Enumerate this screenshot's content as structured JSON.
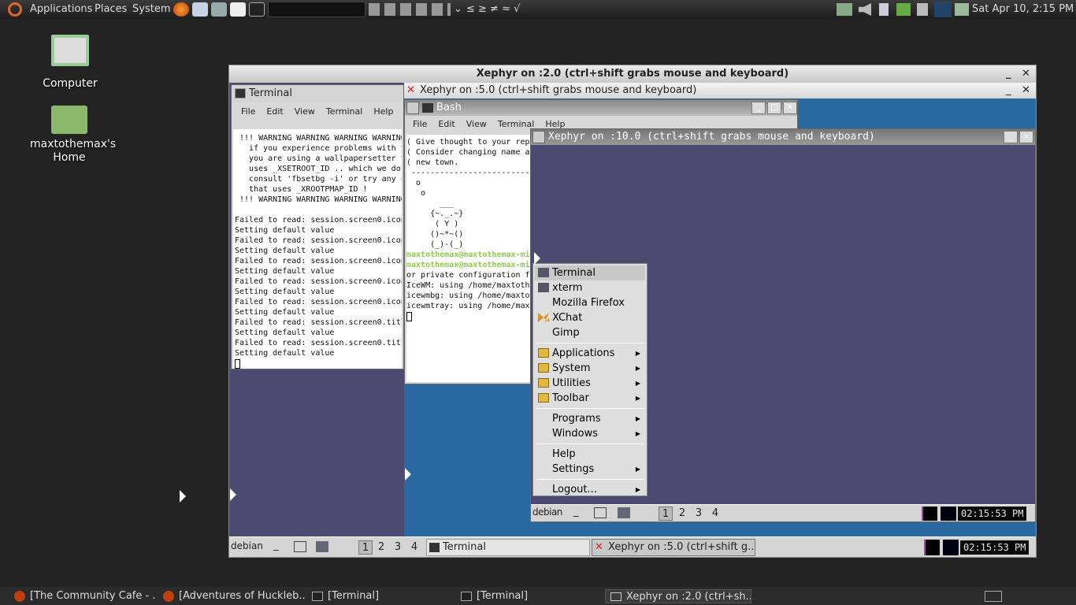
{
  "topbar": {
    "menus": [
      "Applications",
      "Places",
      "System"
    ],
    "symbols": "≤ ≥ ≠ ≈ √",
    "datetime": "Sat Apr 10,  2:15 PM"
  },
  "desktop": {
    "icons": [
      {
        "label": "Computer"
      },
      {
        "label": "maxtothemax's Home"
      }
    ]
  },
  "xephyr2": {
    "title": "Xephyr on :2.0 (ctrl+shift grabs mouse and keyboard)",
    "terminal": {
      "title": "Terminal",
      "menu": [
        "File",
        "Edit",
        "View",
        "Terminal",
        "Help"
      ],
      "lines": [
        " !!! WARNING WARNING WARNING WARNING",
        "   if you experience problems with t",
        "   you are using a wallpapersetter t",
        "   uses _XSETROOT_ID .. which we do",
        "   consult 'fbsetbg -i' or try any c",
        "   that uses _XROOTPMAP_ID !",
        " !!! WARNING WARNING WARNING WARNING",
        "",
        "Failed to read: session.screen0.icon",
        "Setting default value",
        "Failed to read: session.screen0.icon",
        "Setting default value",
        "Failed to read: session.screen0.icon",
        "Setting default value",
        "Failed to read: session.screen0.icon",
        "Setting default value",
        "Failed to read: session.screen0.icon",
        "Setting default value",
        "Failed to read: session.screen0.titl",
        "Setting default value",
        "Failed to read: session.screen0.titl",
        "Setting default value"
      ]
    },
    "taskbar": {
      "logo": "debian",
      "workspaces": [
        "1",
        "2",
        "3",
        "4"
      ],
      "tasks": [
        "Terminal",
        "Xephyr on :5.0 (ctrl+shift g..."
      ],
      "clock": "02:15:53 PM"
    }
  },
  "xephyr5": {
    "title": "Xephyr on :5.0 (ctrl+shift grabs mouse and keyboard)",
    "bash": {
      "title": "Bash",
      "menu": [
        "File",
        "Edit",
        "View",
        "Terminal",
        "Help"
      ],
      "lines": [
        "( Give thought to your rep",
        "( Consider changing name a",
        "( new town.",
        " -----------------------------",
        "  o",
        "   o",
        "       ___",
        "     {~._.~}",
        "      ( Y )",
        "     ()~*~()",
        "     (_)-(_)"
      ],
      "prompt_lines": [
        "maxtothemax@maxtothemax-mi",
        "maxtothemax@maxtothemax-mi"
      ],
      "tail_lines": [
        "or private configuration f",
        "IceWM: using /home/maxtoth",
        "icewmbg: using /home/maxto",
        "icewmtray: using /home/max"
      ]
    }
  },
  "xephyr10": {
    "title": "Xephyr on :10.0 (ctrl+shift grabs mouse and keyboard)",
    "menu": {
      "apps": [
        "Terminal",
        "xterm",
        "Mozilla Firefox",
        "XChat",
        "Gimp"
      ],
      "folders": [
        "Applications",
        "System",
        "Utilities",
        "Toolbar"
      ],
      "group2": [
        "Programs",
        "Windows"
      ],
      "group3": [
        "Help",
        "Settings"
      ],
      "logout": "Logout..."
    },
    "taskbar": {
      "logo": "debian",
      "workspaces": [
        "1",
        "2",
        "3",
        "4"
      ],
      "clock": "02:15:53 PM"
    }
  },
  "bottombar": {
    "tasks": [
      "[The Community Cafe - ...",
      "[Adventures of Huckleb...",
      "[Terminal]",
      "[Terminal]",
      "Xephyr on :2.0 (ctrl+sh..."
    ]
  },
  "colors": {
    "xephyr_bg": "#4c4a70",
    "xephyr5_bg": "#2a6aa0",
    "accent_green": "#8fd04a"
  }
}
